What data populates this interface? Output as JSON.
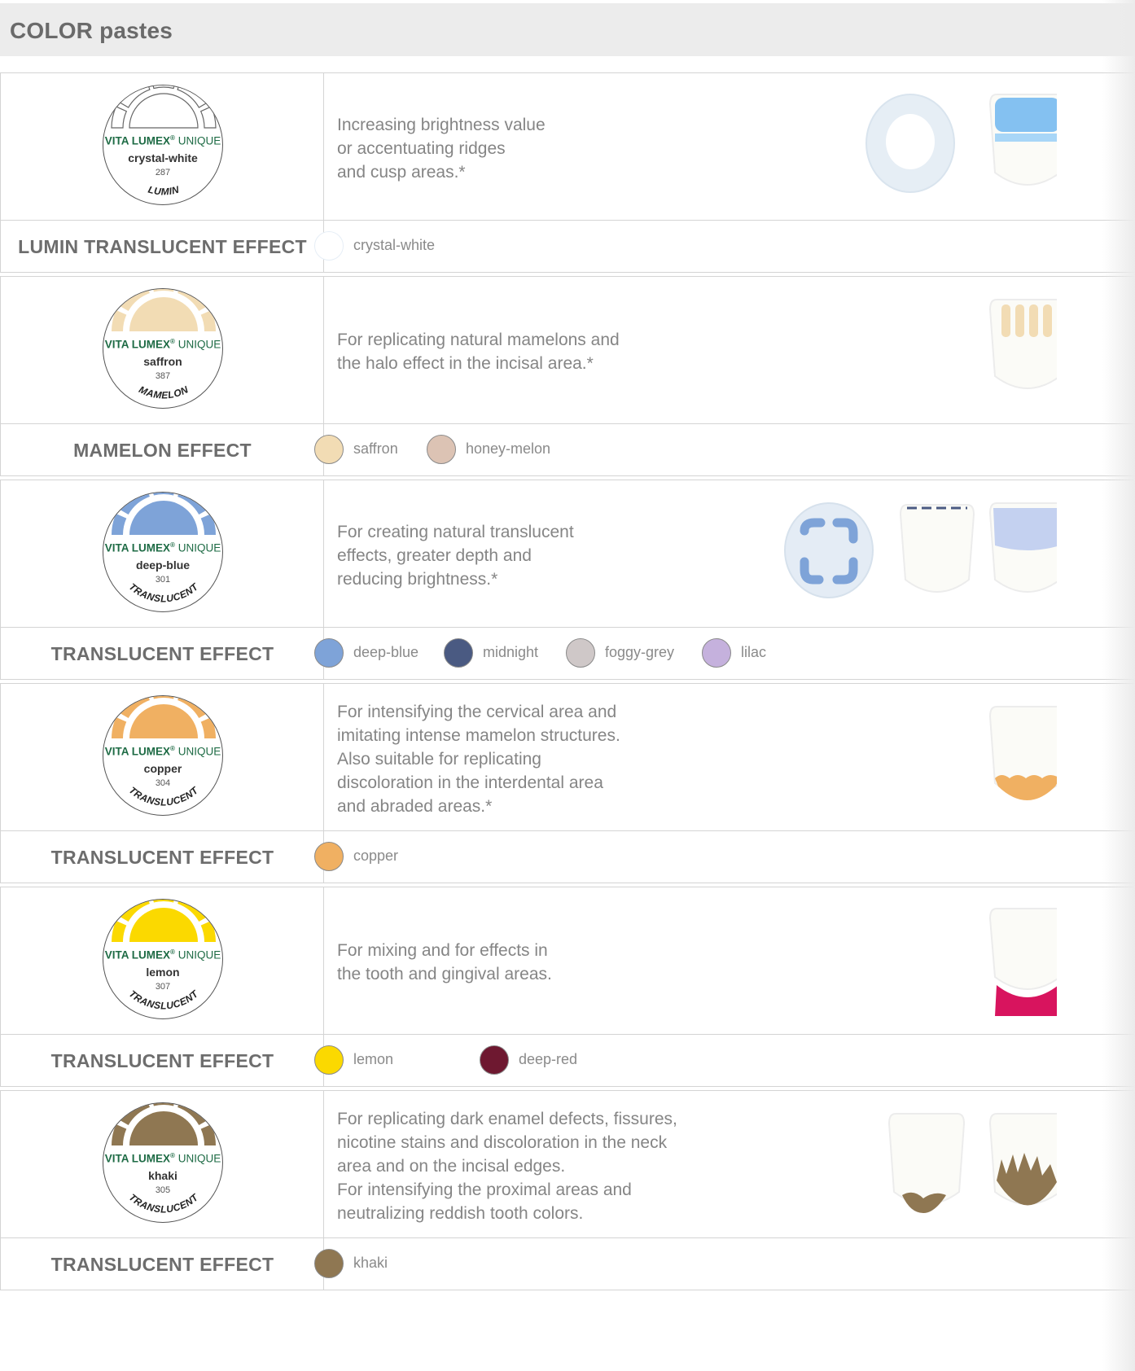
{
  "page_title": "COLOR pastes",
  "brand": {
    "name": "VITA LUMEX",
    "reg": "®",
    "suffix": "UNIQUE"
  },
  "rows": [
    {
      "badge": {
        "shade": "crystal-white",
        "code": "287",
        "category": "LUMIN",
        "color": "#ffffff",
        "outline": true
      },
      "description": [
        "Increasing brightness value",
        "or accentuating ridges",
        "and cusp areas.*"
      ],
      "label": "LUMIN TRANSLUCENT EFFECT",
      "swatches": [
        {
          "name": "crystal-white",
          "color": "#ffffff"
        }
      ]
    },
    {
      "badge": {
        "shade": "saffron",
        "code": "387",
        "category": "MAMELON",
        "color": "#f2dcb4"
      },
      "description": [
        "For replicating natural mamelons and",
        "the halo effect in the incisal area.*"
      ],
      "label": "MAMELON EFFECT",
      "swatches": [
        {
          "name": "saffron",
          "color": "#f2dcb4"
        },
        {
          "name": "honey-melon",
          "color": "#dcc3b4"
        }
      ]
    },
    {
      "badge": {
        "shade": "deep-blue",
        "code": "301",
        "category": "TRANSLUCENT",
        "color": "#7ea3d8"
      },
      "description": [
        "For creating natural translucent",
        "effects, greater depth and",
        "reducing brightness.*"
      ],
      "label": "TRANSLUCENT EFFECT",
      "swatches": [
        {
          "name": "deep-blue",
          "color": "#7ea3d8"
        },
        {
          "name": "midnight",
          "color": "#4a5a82"
        },
        {
          "name": "foggy-grey",
          "color": "#cfc8c8"
        },
        {
          "name": "lilac",
          "color": "#c5b1dd"
        }
      ]
    },
    {
      "badge": {
        "shade": "copper",
        "code": "304",
        "category": "TRANSLUCENT",
        "color": "#f0b062"
      },
      "description": [
        "For intensifying the cervical area and",
        "imitating intense mamelon structures.",
        "Also suitable for replicating",
        "discoloration in the interdental area",
        "and abraded areas.*"
      ],
      "label": "TRANSLUCENT EFFECT",
      "swatches": [
        {
          "name": "copper",
          "color": "#f0b062"
        }
      ]
    },
    {
      "badge": {
        "shade": "lemon",
        "code": "307",
        "category": "TRANSLUCENT",
        "color": "#fbd900"
      },
      "description": [
        "For mixing and for effects in",
        "the tooth and gingival areas."
      ],
      "label": "TRANSLUCENT EFFECT",
      "swatches": [
        {
          "name": "lemon",
          "color": "#fbd900"
        },
        {
          "name": "deep-red",
          "color": "#6e1830"
        }
      ]
    },
    {
      "badge": {
        "shade": "khaki",
        "code": "305",
        "category": "TRANSLUCENT",
        "color": "#8f7752"
      },
      "description": [
        "For replicating dark enamel defects, fissures,",
        "nicotine stains and discoloration in the neck",
        "area and on the incisal edges.",
        "For intensifying the proximal areas and",
        "neutralizing reddish tooth colors."
      ],
      "label": "TRANSLUCENT EFFECT",
      "swatches": [
        {
          "name": "khaki",
          "color": "#8f7752"
        }
      ]
    }
  ]
}
